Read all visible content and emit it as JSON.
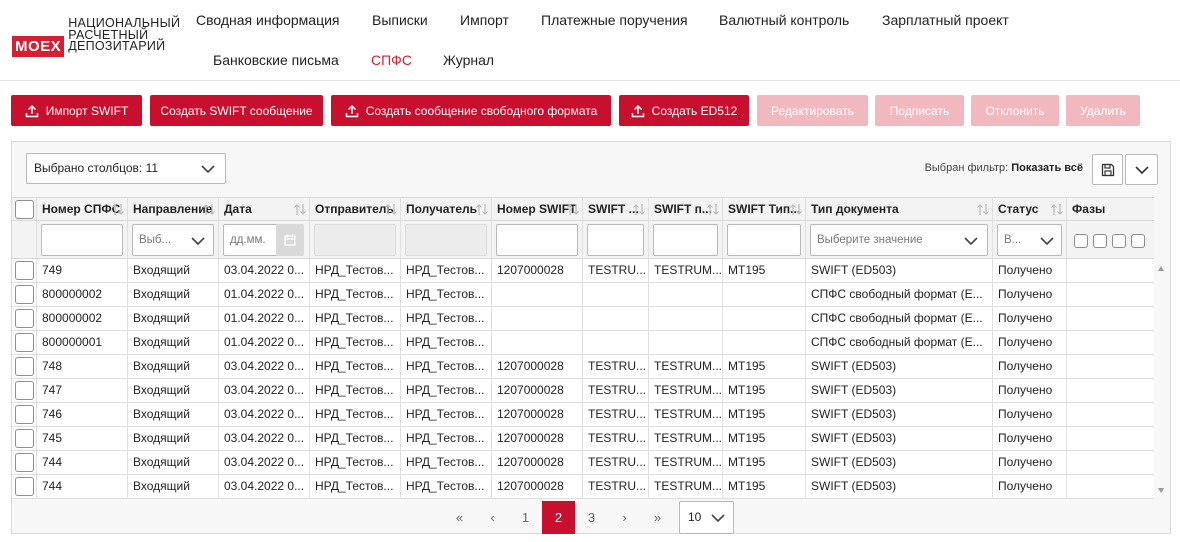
{
  "brand": {
    "logo_mark": "MOEX",
    "name_lines": [
      "НАЦИОНАЛЬНЫЙ",
      "РАСЧЕТНЫЙ",
      "ДЕПОЗИТАРИЙ"
    ]
  },
  "nav": {
    "items": [
      {
        "label": "Сводная информация"
      },
      {
        "label": "Выписки"
      },
      {
        "label": "Импорт"
      },
      {
        "label": "Платежные поручения"
      },
      {
        "label": "Валютный контроль"
      },
      {
        "label": "Зарплатный проект"
      },
      {
        "label": "Банковские письма"
      },
      {
        "label": "СПФС"
      },
      {
        "label": "Журнал"
      }
    ],
    "active": "СПФС"
  },
  "toolbar": {
    "buttons": [
      {
        "label": "Импорт SWIFT",
        "icon": "upload-icon",
        "enabled": true
      },
      {
        "label": "Создать SWIFT сообщение",
        "enabled": true
      },
      {
        "label": "Создать сообщение свободного формата",
        "icon": "upload-icon",
        "enabled": true
      },
      {
        "label": "Создать ED512",
        "icon": "upload-icon",
        "enabled": true
      },
      {
        "label": "Редактировать",
        "enabled": false
      },
      {
        "label": "Подписать",
        "enabled": false
      },
      {
        "label": "Отклонить",
        "enabled": false
      },
      {
        "label": "Удалить",
        "enabled": false
      }
    ]
  },
  "grid_controls": {
    "columns_selected": "Выбрано столбцов: 11",
    "filter_label": "Выбран фильтр:",
    "filter_value": "Показать всё",
    "save_icon": "floppy-disk-icon",
    "more_icon": "chevron-down-icon"
  },
  "table": {
    "columns": [
      "Номер СПФС",
      "Направление",
      "Дата",
      "Отправитель",
      "Получатель",
      "Номер SWIFT",
      "SWIFT ...",
      "SWIFT п...",
      "SWIFT Тип...",
      "Тип документа",
      "Статус",
      "Фазы"
    ],
    "filters": {
      "direction": "Выб...",
      "date": "дд.мм.",
      "doc_type": "Выберите значение",
      "status": "В..."
    },
    "rows": [
      [
        "749",
        "Входящий",
        "03.04.2022 0...",
        "НРД_Тестов...",
        "НРД_Тестов...",
        "1207000028",
        "TESTRU...",
        "TESTRUM...",
        "MT195",
        "SWIFT (ED503)",
        "Получено"
      ],
      [
        "800000002",
        "Входящий",
        "01.04.2022 0...",
        "НРД_Тестов...",
        "НРД_Тестов...",
        "",
        "",
        "",
        "",
        "СПФС свободный формат (Е...",
        "Получено"
      ],
      [
        "800000002",
        "Входящий",
        "01.04.2022 0...",
        "НРД_Тестов...",
        "НРД_Тестов...",
        "",
        "",
        "",
        "",
        "СПФС свободный формат (Е...",
        "Получено"
      ],
      [
        "800000001",
        "Входящий",
        "01.04.2022 0...",
        "НРД_Тестов...",
        "НРД_Тестов...",
        "",
        "",
        "",
        "",
        "СПФС свободный формат (Е...",
        "Получено"
      ],
      [
        "748",
        "Входящий",
        "03.04.2022 0...",
        "НРД_Тестов...",
        "НРД_Тестов...",
        "1207000028",
        "TESTRU...",
        "TESTRUM...",
        "MT195",
        "SWIFT (ED503)",
        "Получено"
      ],
      [
        "747",
        "Входящий",
        "03.04.2022 0...",
        "НРД_Тестов...",
        "НРД_Тестов...",
        "1207000028",
        "TESTRU...",
        "TESTRUM...",
        "MT195",
        "SWIFT (ED503)",
        "Получено"
      ],
      [
        "746",
        "Входящий",
        "03.04.2022 0...",
        "НРД_Тестов...",
        "НРД_Тестов...",
        "1207000028",
        "TESTRU...",
        "TESTRUM...",
        "MT195",
        "SWIFT (ED503)",
        "Получено"
      ],
      [
        "745",
        "Входящий",
        "03.04.2022 0...",
        "НРД_Тестов...",
        "НРД_Тестов...",
        "1207000028",
        "TESTRU...",
        "TESTRUM...",
        "MT195",
        "SWIFT (ED503)",
        "Получено"
      ],
      [
        "744",
        "Входящий",
        "03.04.2022 0...",
        "НРД_Тестов...",
        "НРД_Тестов...",
        "1207000028",
        "TESTRU...",
        "TESTRUM...",
        "MT195",
        "SWIFT (ED503)",
        "Получено"
      ],
      [
        "744",
        "Входящий",
        "03.04.2022 0...",
        "НРД_Тестов...",
        "НРД_Тестов...",
        "1207000028",
        "TESTRU...",
        "TESTRUM...",
        "MT195",
        "SWIFT (ED503)",
        "Получено"
      ]
    ]
  },
  "pagination": {
    "first": "«",
    "prev": "‹",
    "pages": [
      "1",
      "2",
      "3"
    ],
    "current": "2",
    "next": "›",
    "last": "»",
    "page_size": "10"
  },
  "colors": {
    "accent": "#c8102e",
    "accent_disabled": "#f2b8c0",
    "logo": "#d81f31"
  }
}
